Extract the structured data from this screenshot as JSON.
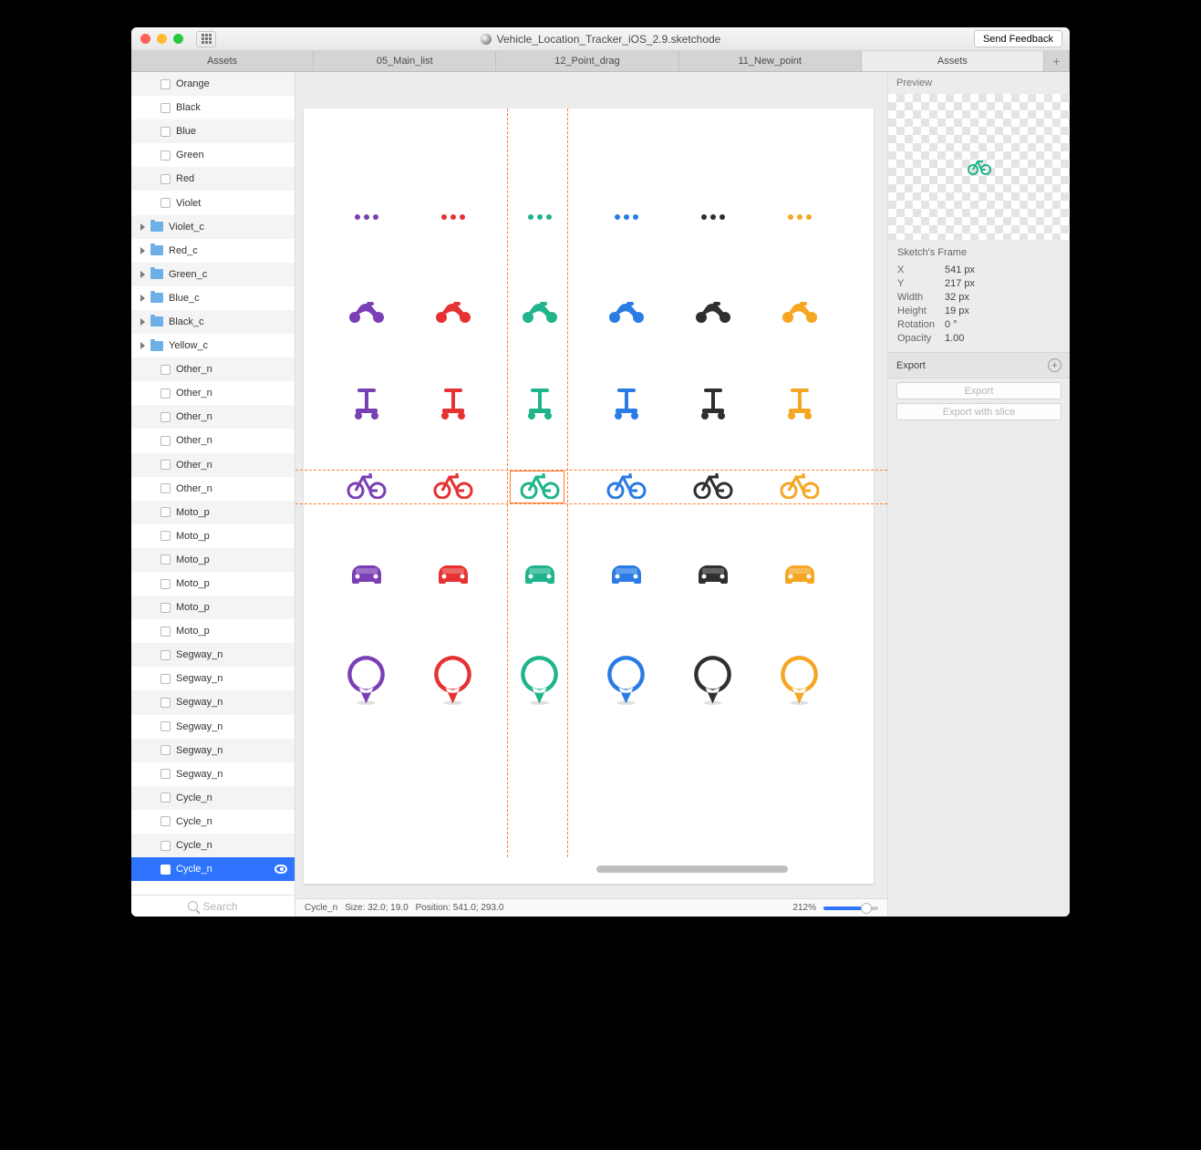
{
  "window": {
    "title": "Vehicle_Location_Tracker_iOS_2.9.sketchode",
    "feedback": "Send Feedback"
  },
  "tabs": [
    {
      "label": "Assets",
      "active": false
    },
    {
      "label": "05_Main_list",
      "active": false
    },
    {
      "label": "12_Point_drag",
      "active": false
    },
    {
      "label": "11_New_point",
      "active": false
    },
    {
      "label": "Assets",
      "active": true
    }
  ],
  "sidebar": {
    "items": [
      {
        "label": "Orange",
        "type": "layer"
      },
      {
        "label": "Black",
        "type": "layer"
      },
      {
        "label": "Blue",
        "type": "layer"
      },
      {
        "label": "Green",
        "type": "layer"
      },
      {
        "label": "Red",
        "type": "layer"
      },
      {
        "label": "Violet",
        "type": "layer"
      },
      {
        "label": "Violet_c",
        "type": "folder"
      },
      {
        "label": "Red_c",
        "type": "folder"
      },
      {
        "label": "Green_c",
        "type": "folder"
      },
      {
        "label": "Blue_c",
        "type": "folder"
      },
      {
        "label": "Black_c",
        "type": "folder"
      },
      {
        "label": "Yellow_c",
        "type": "folder"
      },
      {
        "label": "Other_n",
        "type": "layer"
      },
      {
        "label": "Other_n",
        "type": "layer"
      },
      {
        "label": "Other_n",
        "type": "layer"
      },
      {
        "label": "Other_n",
        "type": "layer"
      },
      {
        "label": "Other_n",
        "type": "layer"
      },
      {
        "label": "Other_n",
        "type": "layer"
      },
      {
        "label": "Moto_p",
        "type": "layer"
      },
      {
        "label": "Moto_p",
        "type": "layer"
      },
      {
        "label": "Moto_p",
        "type": "layer"
      },
      {
        "label": "Moto_p",
        "type": "layer"
      },
      {
        "label": "Moto_p",
        "type": "layer"
      },
      {
        "label": "Moto_p",
        "type": "layer"
      },
      {
        "label": "Segway_n",
        "type": "layer"
      },
      {
        "label": "Segway_n",
        "type": "layer"
      },
      {
        "label": "Segway_n",
        "type": "layer"
      },
      {
        "label": "Segway_n",
        "type": "layer"
      },
      {
        "label": "Segway_n",
        "type": "layer"
      },
      {
        "label": "Segway_n",
        "type": "layer"
      },
      {
        "label": "Cycle_n",
        "type": "layer"
      },
      {
        "label": "Cycle_n",
        "type": "layer"
      },
      {
        "label": "Cycle_n",
        "type": "layer"
      },
      {
        "label": "Cycle_n",
        "type": "layer",
        "selected": true
      }
    ],
    "search_placeholder": "Search"
  },
  "colors": [
    "#7b3fb5",
    "#e63232",
    "#1fb48b",
    "#2a7be4",
    "#2f2f2f",
    "#f5a623"
  ],
  "inspector": {
    "preview_label": "Preview",
    "frame_title": "Sketch's Frame",
    "props": {
      "X": "541 px",
      "Y": "217 px",
      "Width": "32 px",
      "Height": "19 px",
      "Rotation": "0 °",
      "Opacity": "1.00"
    },
    "export_label": "Export",
    "export_btn": "Export",
    "export_slice_btn": "Export with slice"
  },
  "status": {
    "name": "Cycle_n",
    "size": "Size: 32.0; 19.0",
    "position": "Position: 541.0; 293.0",
    "zoom": "212%"
  }
}
